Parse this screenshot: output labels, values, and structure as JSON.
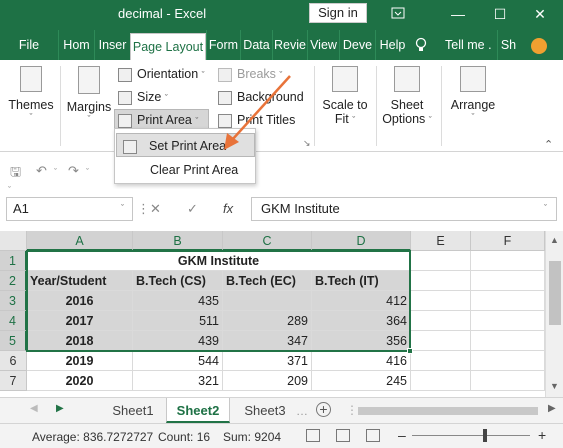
{
  "window": {
    "title": "decimal  -  Excel",
    "sign_in": "Sign in"
  },
  "tabs": [
    {
      "label": "File"
    },
    {
      "label": "Hom"
    },
    {
      "label": "Inser"
    },
    {
      "label": "Page Layout"
    },
    {
      "label": "Form"
    },
    {
      "label": "Data"
    },
    {
      "label": "Revie"
    },
    {
      "label": "View"
    },
    {
      "label": "Deve"
    },
    {
      "label": "Help"
    }
  ],
  "tell_me": "Tell me",
  "share": "Sh",
  "ribbon": {
    "themes": "Themes",
    "margins": "Margins",
    "orientation": "Orientation",
    "size": "Size",
    "print_area": "Print Area",
    "breaks": "Breaks",
    "background": "Background",
    "print_titles": "Print Titles",
    "scale_to_fit": [
      "Scale to",
      "Fit"
    ],
    "sheet_options": [
      "Sheet",
      "Options"
    ],
    "arrange": "Arrange"
  },
  "print_area_menu": {
    "set": "Set Print Area",
    "clear": "Clear Print Area"
  },
  "name_box": "A1",
  "formula": "GKM Institute",
  "columns": [
    "A",
    "B",
    "C",
    "D",
    "E",
    "F"
  ],
  "rows": [
    "1",
    "2",
    "3",
    "4",
    "5",
    "6",
    "7"
  ],
  "sheet": {
    "title": "GKM Institute",
    "headers": [
      "Year/Student",
      "B.Tech (CS)",
      "B.Tech (EC)",
      "B.Tech (IT)"
    ],
    "data": [
      {
        "year": "2016",
        "cs": "435",
        "ec": "",
        "it": "412"
      },
      {
        "year": "2017",
        "cs": "511",
        "ec": "289",
        "it": "364"
      },
      {
        "year": "2018",
        "cs": "439",
        "ec": "347",
        "it": "356"
      },
      {
        "year": "2019",
        "cs": "544",
        "ec": "371",
        "it": "416"
      },
      {
        "year": "2020",
        "cs": "321",
        "ec": "209",
        "it": "245"
      }
    ]
  },
  "sheet_tabs": [
    {
      "label": "Sheet1"
    },
    {
      "label": "Sheet2"
    },
    {
      "label": "Sheet3"
    }
  ],
  "status": {
    "average": "Average: 836.7272727",
    "count": "Count: 16",
    "sum": "Sum: 9204"
  },
  "colors": {
    "excel_green": "#1e7145",
    "arrow": "#e8733a",
    "print_area_shade": "#d6d6d6"
  }
}
